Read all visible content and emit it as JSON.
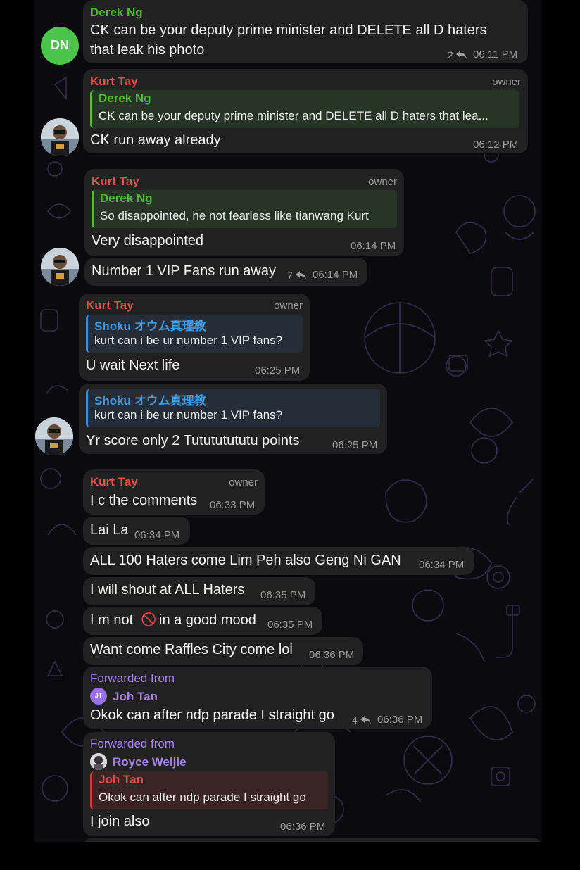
{
  "colors": {
    "kurt": "#e2524c",
    "derek": "#4dbb32",
    "shoku": "#3f9ae0",
    "forwarded": "#a884e8",
    "bubble": "#212121"
  },
  "icons": {
    "reply": "reply-arrow-icon"
  },
  "messages": {
    "m1": {
      "name": "Derek Ng",
      "text1": "CK can be your deputy prime minister and DELETE all D haters",
      "text2": "that leak his photo",
      "replies": "2",
      "time": "06:11 PM",
      "avatar": "DN"
    },
    "m2": {
      "name": "Kurt Tay",
      "role": "owner",
      "quote_name": "Derek Ng",
      "quote_text": "CK can be your deputy prime minister and DELETE all D haters that lea...",
      "text": "CK run away already",
      "time": "06:12 PM"
    },
    "m3": {
      "name": "Kurt Tay",
      "role": "owner",
      "quote_name": "Derek Ng",
      "quote_text": "So disappointed, he not fearless like tianwang Kurt",
      "text": "Very disappointed",
      "time": "06:14 PM"
    },
    "m4": {
      "text": "Number 1 VIP Fans run away",
      "replies": "7",
      "time": "06:14 PM"
    },
    "m5": {
      "name": "Kurt Tay",
      "role": "owner",
      "quote_name": "Shoku オウム真理教",
      "quote_text": "kurt can i be ur number 1 VIP fans?",
      "text": "U wait Next life",
      "time": "06:25 PM"
    },
    "m6": {
      "quote_name": "Shoku オウム真理教",
      "quote_text": "kurt can i be ur number 1 VIP fans?",
      "text": "Yr score only 2 Tutututututu points",
      "time": "06:25 PM"
    },
    "m7": {
      "name": "Kurt Tay",
      "role": "owner",
      "text": "I c the comments",
      "time": "06:33 PM"
    },
    "m8": {
      "text": "Lai La",
      "time": "06:34 PM"
    },
    "m9": {
      "text": "ALL 100 Haters come Lim Peh also Geng Ni GAN",
      "time": "06:34 PM"
    },
    "m10": {
      "text": "I will shout at ALL Haters",
      "time": "06:35 PM"
    },
    "m11": {
      "text_before": "I m not",
      "emoji": "🚫",
      "text_after": "in a good mood",
      "time": "06:35 PM"
    },
    "m12": {
      "text": "Want come Raffles City come lol",
      "time": "06:36 PM"
    },
    "m13": {
      "forwarded": "Forwarded from",
      "from_initials": "JT",
      "from": "Joh Tan",
      "text": "Okok can after ndp parade I straight go",
      "replies": "4",
      "time": "06:36 PM"
    },
    "m14": {
      "forwarded": "Forwarded from",
      "from": "Royce Weijie",
      "quote_name": "Joh Tan",
      "quote_text": "Okok can after ndp parade I straight go",
      "text": "I join also",
      "time": "06:36 PM"
    }
  }
}
